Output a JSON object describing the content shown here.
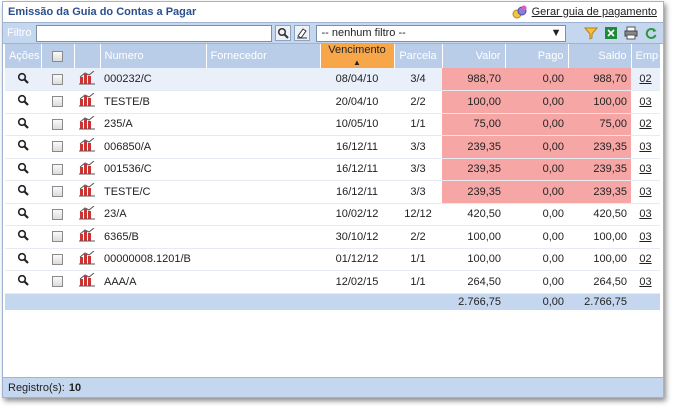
{
  "header": {
    "title": "Emissão da Guia do Contas a Pagar",
    "generate_link": "Gerar guia de pagamento"
  },
  "filterbar": {
    "label": "Filtro",
    "input_value": "",
    "select_value": "-- nenhum filtro --"
  },
  "columns": [
    "Ações",
    "",
    "",
    "Numero",
    "Fornecedor",
    "Vencimento",
    "Parcela",
    "Valor",
    "Pago",
    "Saldo",
    "Emp"
  ],
  "rows": [
    {
      "numero": "000232/C",
      "fornecedor": "",
      "vencimento": "08/04/10",
      "parcela": "3/4",
      "valor": "988,70",
      "pago": "0,00",
      "saldo": "988,70",
      "emp": "02",
      "overdue": true
    },
    {
      "numero": "TESTE/B",
      "fornecedor": "",
      "vencimento": "20/04/10",
      "parcela": "2/2",
      "valor": "100,00",
      "pago": "0,00",
      "saldo": "100,00",
      "emp": "03",
      "overdue": true
    },
    {
      "numero": "235/A",
      "fornecedor": "",
      "vencimento": "10/05/10",
      "parcela": "1/1",
      "valor": "75,00",
      "pago": "0,00",
      "saldo": "75,00",
      "emp": "02",
      "overdue": true
    },
    {
      "numero": "006850/A",
      "fornecedor": "",
      "vencimento": "16/12/11",
      "parcela": "3/3",
      "valor": "239,35",
      "pago": "0,00",
      "saldo": "239,35",
      "emp": "03",
      "overdue": true
    },
    {
      "numero": "001536/C",
      "fornecedor": "",
      "vencimento": "16/12/11",
      "parcela": "3/3",
      "valor": "239,35",
      "pago": "0,00",
      "saldo": "239,35",
      "emp": "03",
      "overdue": true
    },
    {
      "numero": "TESTE/C",
      "fornecedor": "",
      "vencimento": "16/12/11",
      "parcela": "3/3",
      "valor": "239,35",
      "pago": "0,00",
      "saldo": "239,35",
      "emp": "03",
      "overdue": true
    },
    {
      "numero": "23/A",
      "fornecedor": "",
      "vencimento": "10/02/12",
      "parcela": "12/12",
      "valor": "420,50",
      "pago": "0,00",
      "saldo": "420,50",
      "emp": "03",
      "overdue": false
    },
    {
      "numero": "6365/B",
      "fornecedor": "",
      "vencimento": "30/10/12",
      "parcela": "2/2",
      "valor": "100,00",
      "pago": "0,00",
      "saldo": "100,00",
      "emp": "03",
      "overdue": false
    },
    {
      "numero": "00000008.1201/B",
      "fornecedor": "",
      "vencimento": "01/12/12",
      "parcela": "1/1",
      "valor": "100,00",
      "pago": "0,00",
      "saldo": "100,00",
      "emp": "02",
      "overdue": false
    },
    {
      "numero": "AAA/A",
      "fornecedor": "",
      "vencimento": "12/02/15",
      "parcela": "1/1",
      "valor": "264,50",
      "pago": "0,00",
      "saldo": "264,50",
      "emp": "03",
      "overdue": false
    }
  ],
  "totals": {
    "valor": "2.766,75",
    "pago": "0,00",
    "saldo": "2.766,75"
  },
  "status": {
    "label": "Registro(s):",
    "count": "10"
  },
  "colors": {
    "header_bg": "#b9cde9",
    "sorted_header": "#f7a74a",
    "overdue_bg": "#f7a6a6",
    "title": "#2a4f8c"
  }
}
